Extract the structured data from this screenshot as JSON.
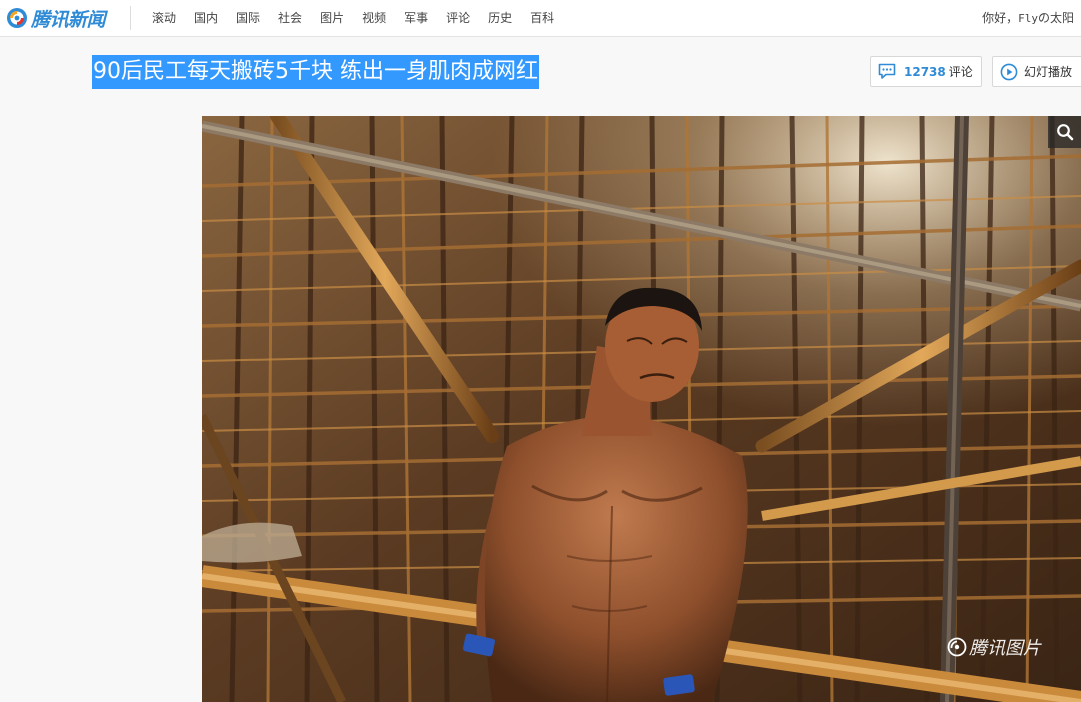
{
  "header": {
    "logo_text": "腾讯新闻",
    "nav": [
      "滚动",
      "国内",
      "国际",
      "社会",
      "图片",
      "视频",
      "军事",
      "评论",
      "历史",
      "百科"
    ],
    "greeting": "你好，",
    "username": "Fly",
    "username_suffix": "の太阳"
  },
  "article": {
    "title": "90后民工每天搬砖5千块 练出一身肌肉成网红",
    "comment_count": "12738",
    "comment_label": "评论",
    "slideshow_label": "幻灯播放"
  },
  "photo": {
    "watermark": "腾讯图片"
  },
  "colors": {
    "brand": "#2f8bd6",
    "selection": "#3399ff"
  }
}
